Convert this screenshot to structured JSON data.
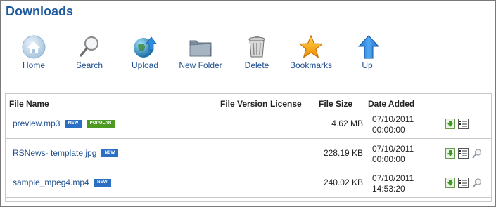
{
  "header": {
    "title": "Downloads"
  },
  "toolbar": {
    "home": "Home",
    "search": "Search",
    "upload": "Upload",
    "new_folder": "New Folder",
    "delete": "Delete",
    "bookmarks": "Bookmarks",
    "up": "Up"
  },
  "table": {
    "columns": {
      "file_name": "File Name",
      "file_version": "File Version",
      "license": "License",
      "file_size": "File Size",
      "date_added": "Date Added"
    },
    "rows": [
      {
        "name": "preview.mp3",
        "badges": [
          "NEW",
          "POPULAR"
        ],
        "size": "4.62 MB",
        "date": "07/10/2011",
        "time": "00:00:00",
        "actions": [
          "download-icon",
          "details-icon"
        ]
      },
      {
        "name": "RSNews- template.jpg",
        "badges": [
          "NEW"
        ],
        "size": "228.19 KB",
        "date": "07/10/2011",
        "time": "00:00:00",
        "actions": [
          "download-icon",
          "details-icon",
          "preview-magnifier-icon"
        ]
      },
      {
        "name": "sample_mpeg4.mp4",
        "badges": [
          "NEW"
        ],
        "size": "240.02 KB",
        "date": "07/10/2011",
        "time": "14:53:20",
        "actions": [
          "download-icon",
          "details-icon",
          "preview-magnifier-icon"
        ]
      }
    ]
  },
  "colors": {
    "title": "#1f5a9e",
    "link": "#1f4f8f",
    "badge_new": "#2b6fc2",
    "badge_popular": "#4d9a23"
  }
}
